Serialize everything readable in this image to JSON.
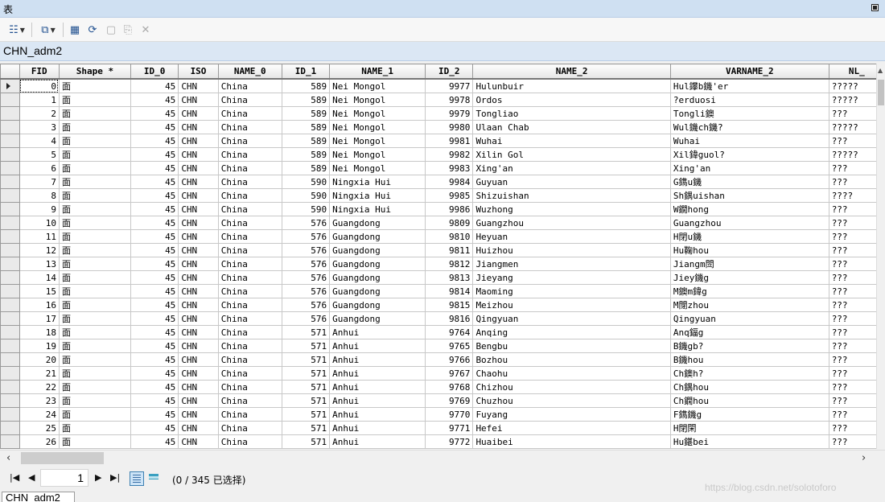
{
  "window": {
    "title": "表"
  },
  "toolbar": {
    "buttons": [
      {
        "icon": "table-options-icon"
      },
      {
        "icon": "related-tables-icon"
      },
      {
        "icon": "select-by-attributes-icon"
      },
      {
        "icon": "switch-selection-icon"
      },
      {
        "icon": "clear-selection-icon"
      },
      {
        "icon": "copy-selected-records-icon"
      },
      {
        "icon": "delete-selected-icon"
      }
    ]
  },
  "table_tab": {
    "name": "CHN_adm2"
  },
  "grid": {
    "columns": [
      "FID",
      "Shape *",
      "ID_0",
      "ISO",
      "NAME_0",
      "ID_1",
      "NAME_1",
      "ID_2",
      "NAME_2",
      "VARNAME_2",
      "NL_"
    ],
    "rows": [
      [
        "0",
        "面",
        "45",
        "CHN",
        "China",
        "589",
        "Nei Mongol",
        "9977",
        "Hulunbuir",
        "Hul鑻b鐖'er",
        "?????"
      ],
      [
        "1",
        "面",
        "45",
        "CHN",
        "China",
        "589",
        "Nei Mongol",
        "9978",
        "Ordos",
        "?erduosi",
        "?????"
      ],
      [
        "2",
        "面",
        "45",
        "CHN",
        "China",
        "589",
        "Nei Mongol",
        "9979",
        "Tongliao",
        "Tongli鐭",
        "???"
      ],
      [
        "3",
        "面",
        "45",
        "CHN",
        "China",
        "589",
        "Nei Mongol",
        "9980",
        "Ulaan Chab",
        "Wul鐖ch鐖?",
        "?????"
      ],
      [
        "4",
        "面",
        "45",
        "CHN",
        "China",
        "589",
        "Nei Mongol",
        "9981",
        "Wuhai",
        "Wuhai",
        "???"
      ],
      [
        "5",
        "面",
        "45",
        "CHN",
        "China",
        "589",
        "Nei Mongol",
        "9982",
        "Xilin Gol",
        "Xil鍏guol?",
        "?????"
      ],
      [
        "6",
        "面",
        "45",
        "CHN",
        "China",
        "589",
        "Nei Mongol",
        "9983",
        "Xing'an",
        "Xing'an",
        "???"
      ],
      [
        "7",
        "面",
        "45",
        "CHN",
        "China",
        "590",
        "Ningxia Hui",
        "9984",
        "Guyuan",
        "G鐫u鐖",
        "???"
      ],
      [
        "8",
        "面",
        "45",
        "CHN",
        "China",
        "590",
        "Ningxia Hui",
        "9985",
        "Shizuishan",
        "Sh鍝uishan",
        "????"
      ],
      [
        "9",
        "面",
        "45",
        "CHN",
        "China",
        "590",
        "Ningxia Hui",
        "9986",
        "Wuzhong",
        "W鐗hong",
        "???"
      ],
      [
        "10",
        "面",
        "45",
        "CHN",
        "China",
        "576",
        "Guangdong",
        "9809",
        "Guangzhou",
        "Guangzhou",
        "???"
      ],
      [
        "11",
        "面",
        "45",
        "CHN",
        "China",
        "576",
        "Guangdong",
        "9810",
        "Heyuan",
        "H閉u鐖",
        "???"
      ],
      [
        "12",
        "面",
        "45",
        "CHN",
        "China",
        "576",
        "Guangdong",
        "9811",
        "Huizhou",
        "Hu鞠hou",
        "???"
      ],
      [
        "13",
        "面",
        "45",
        "CHN",
        "China",
        "576",
        "Guangdong",
        "9812",
        "Jiangmen",
        "Jiangm閚",
        "???"
      ],
      [
        "14",
        "面",
        "45",
        "CHN",
        "China",
        "576",
        "Guangdong",
        "9813",
        "Jieyang",
        "Jiey鐖g",
        "???"
      ],
      [
        "15",
        "面",
        "45",
        "CHN",
        "China",
        "576",
        "Guangdong",
        "9814",
        "Maoming",
        "M鐭m鍏g",
        "???"
      ],
      [
        "16",
        "面",
        "45",
        "CHN",
        "China",
        "576",
        "Guangdong",
        "9815",
        "Meizhou",
        "M閕zhou",
        "???"
      ],
      [
        "17",
        "面",
        "45",
        "CHN",
        "China",
        "576",
        "Guangdong",
        "9816",
        "Qingyuan",
        "Qingyuan",
        "???"
      ],
      [
        "18",
        "面",
        "45",
        "CHN",
        "China",
        "571",
        "Anhui",
        "9764",
        "Anqing",
        "Anq鍢g",
        "???"
      ],
      [
        "19",
        "面",
        "45",
        "CHN",
        "China",
        "571",
        "Anhui",
        "9765",
        "Bengbu",
        "B鐖gb?",
        "???"
      ],
      [
        "20",
        "面",
        "45",
        "CHN",
        "China",
        "571",
        "Anhui",
        "9766",
        "Bozhou",
        "B鐖hou",
        "???"
      ],
      [
        "21",
        "面",
        "45",
        "CHN",
        "China",
        "571",
        "Anhui",
        "9767",
        "Chaohu",
        "Ch鐭h?",
        "???"
      ],
      [
        "22",
        "面",
        "45",
        "CHN",
        "China",
        "571",
        "Anhui",
        "9768",
        "Chizhou",
        "Ch鍝hou",
        "???"
      ],
      [
        "23",
        "面",
        "45",
        "CHN",
        "China",
        "571",
        "Anhui",
        "9769",
        "Chuzhou",
        "Ch鐗hou",
        "???"
      ],
      [
        "24",
        "面",
        "45",
        "CHN",
        "China",
        "571",
        "Anhui",
        "9770",
        "Fuyang",
        "F鐫鐖g",
        "???"
      ],
      [
        "25",
        "面",
        "45",
        "CHN",
        "China",
        "571",
        "Anhui",
        "9771",
        "Hefei",
        "H閉閑",
        "???"
      ],
      [
        "26",
        "面",
        "45",
        "CHN",
        "China",
        "571",
        "Anhui",
        "9772",
        "Huaibei",
        "Hu鍖bei",
        "???"
      ]
    ]
  },
  "navigation": {
    "current_page": "1",
    "status": "(0 / 345 已选择)"
  },
  "watermark": "https://blog.csdn.net/solotoforo",
  "bottom_tab": {
    "label": "CHN_adm2"
  }
}
